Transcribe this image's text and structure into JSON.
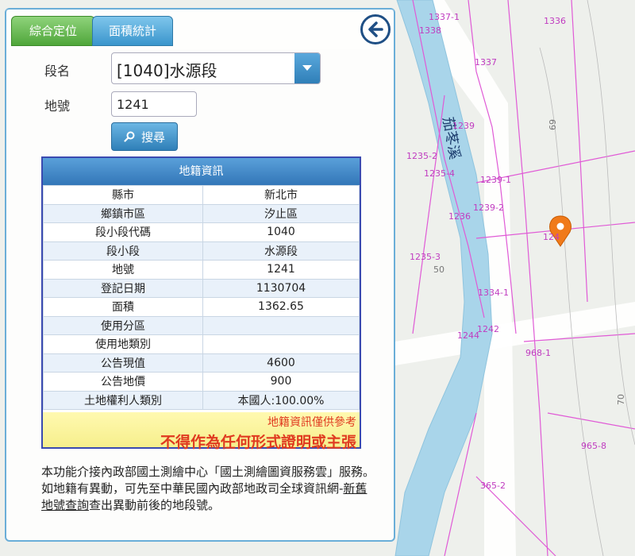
{
  "tabs": [
    {
      "label": "綜合定位"
    },
    {
      "label": "面積統計"
    }
  ],
  "form": {
    "section_label": "段名",
    "section_value": "[1040]水源段",
    "parcel_label": "地號",
    "parcel_value": "1241",
    "search_label": "搜尋"
  },
  "info": {
    "title": "地籍資訊",
    "rows": [
      {
        "k": "縣市",
        "v": "新北市"
      },
      {
        "k": "鄉鎮市區",
        "v": "汐止區"
      },
      {
        "k": "段小段代碼",
        "v": "1040"
      },
      {
        "k": "段小段",
        "v": "水源段"
      },
      {
        "k": "地號",
        "v": "1241"
      },
      {
        "k": "登記日期",
        "v": "1130704"
      },
      {
        "k": "面積",
        "v": "1362.65"
      },
      {
        "k": "使用分區",
        "v": ""
      },
      {
        "k": "使用地類別",
        "v": ""
      },
      {
        "k": "公告現值",
        "v": "4600"
      },
      {
        "k": "公告地價",
        "v": "900"
      },
      {
        "k": "土地權利人類別",
        "v": "本國人:100.00%"
      }
    ],
    "note1": "地籍資訊僅供參考",
    "note2": "不得作為任何形式證明或主張"
  },
  "desc": {
    "p1": "本功能介接內政部國土測繪中心「國土測繪圖資服務雲」服務。",
    "p2_a": "如地籍有異動，可先至中華民國內政部地政司全球資訊網-",
    "p2_link": "新舊地號查詢",
    "p2_b": "查出異動前後的地段號。"
  },
  "map": {
    "stream_label": "茄苳溪",
    "parcels": [
      "1336",
      "1337-1",
      "1338",
      "1337",
      "1239",
      "1239-1",
      "1239-2",
      "1236",
      "1235-2",
      "1235-4",
      "1235-3",
      "1334-1",
      "1242",
      "1244",
      "968-1",
      "965-8",
      "365-2",
      "124",
      "69",
      "70",
      "50"
    ]
  },
  "colors": {
    "tab_active": "#4fa63a",
    "tab_inactive": "#3a95cc",
    "note": "#e03a20",
    "parcel_line": "#e05ad6",
    "stream": "#a9d5ea"
  }
}
